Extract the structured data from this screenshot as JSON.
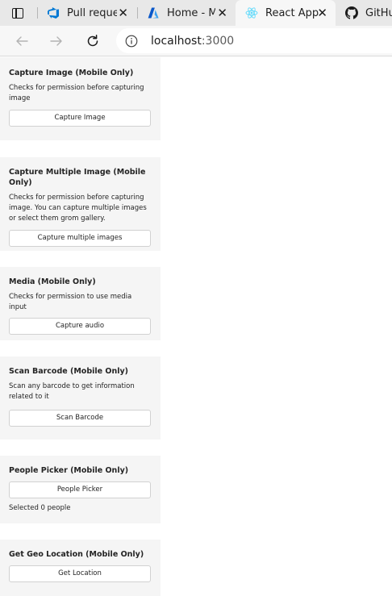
{
  "browser": {
    "tabs": [
      {
        "title": "Pull reque",
        "icon": "azure-devops-icon",
        "active": false
      },
      {
        "title": "Home - Mi",
        "icon": "azure-icon",
        "active": false
      },
      {
        "title": "React App",
        "icon": "react-icon",
        "active": true
      },
      {
        "title": "GitHub",
        "icon": "github-icon",
        "active": false
      }
    ],
    "address": {
      "host": "localhost",
      "port": ":3000"
    }
  },
  "cards": [
    {
      "title": "Capture Image (Mobile Only)",
      "description": "Checks for permission before capturing image",
      "button": "Capture Image"
    },
    {
      "title": "Capture Multiple Image (Mobile Only)",
      "description": "Checks for permission before capturing image. You can capture multiple images or select them grom gallery.",
      "button": "Capture multiple images"
    },
    {
      "title": "Media (Mobile Only)",
      "description": "Checks for permission to use media input",
      "button": "Capture audio"
    },
    {
      "title": "Scan Barcode (Mobile Only)",
      "description": "Scan any barcode to get information related to it",
      "button": "Scan Barcode"
    },
    {
      "title": "People Picker (Mobile Only)",
      "button": "People Picker",
      "status": "Selected 0 people"
    },
    {
      "title": "Get Geo Location (Mobile Only)",
      "button": "Get Location"
    }
  ],
  "colors": {
    "tabstrip": "#e8e8e8",
    "toolbar": "#f7f7f7",
    "card": "#f5f5f5",
    "azure_devops": "#0078d4",
    "react": "#61dafb"
  }
}
